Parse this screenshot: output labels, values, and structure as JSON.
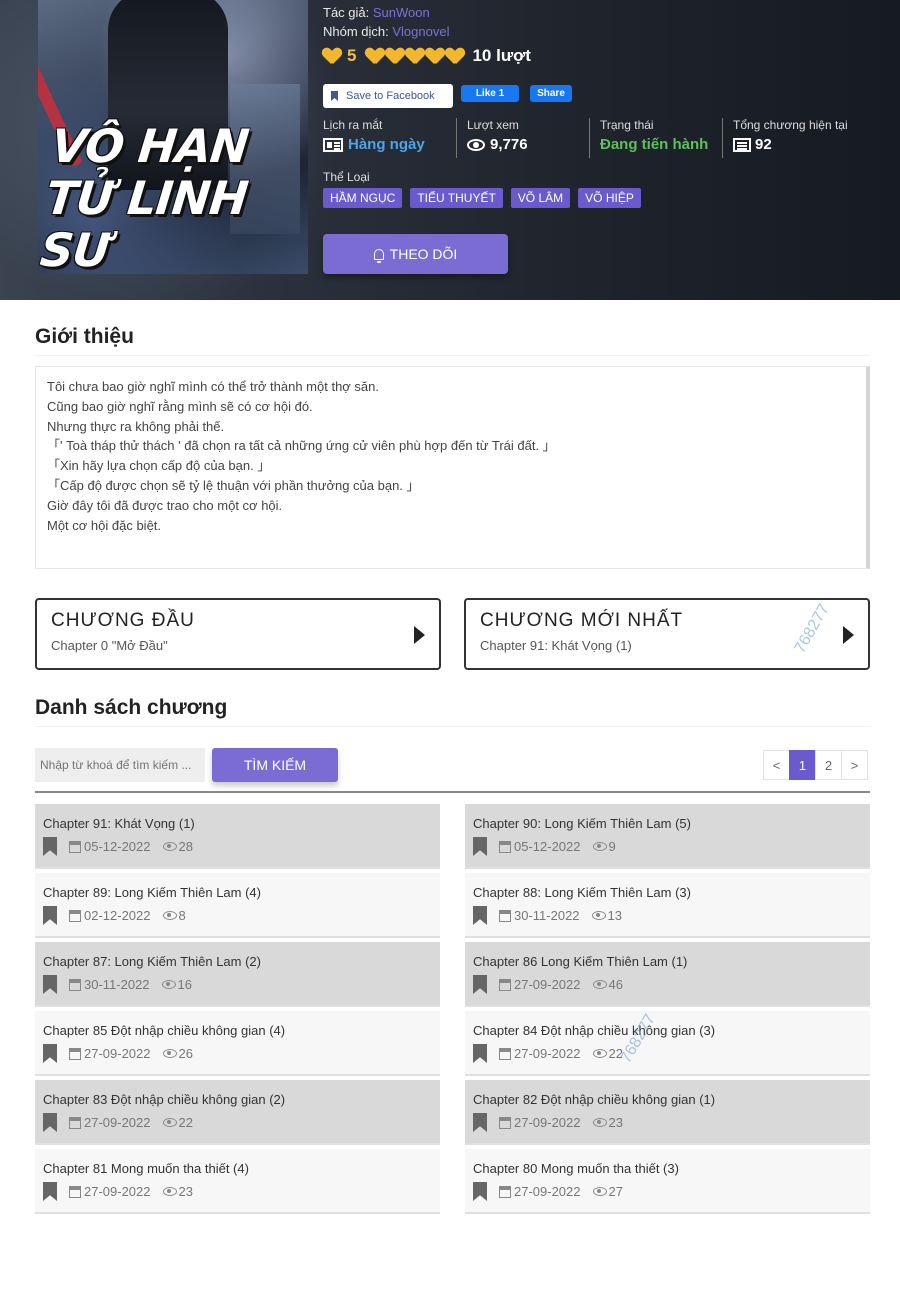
{
  "hero": {
    "cover_title_line1": "VÔ HẠN",
    "cover_title_line2": "TỬ LINH SƯ",
    "author_label": "Tác giả:",
    "author": "SunWoon",
    "group_label": "Nhóm dịch:",
    "group": "Vlognovel",
    "rating_score": "5",
    "rating_votes": "10 lượt",
    "rating_stars": 5,
    "fb_save": "Save to Facebook",
    "fb_like": "Like 1",
    "fb_share": "Share",
    "stats": {
      "release_label": "Lịch ra mắt",
      "release_value": "Hàng ngày",
      "views_label": "Lượt xem",
      "views_value": "9,776",
      "status_label": "Trạng thái",
      "status_value": "Đang tiến hành",
      "chapters_label": "Tổng chương hiện tại",
      "chapters_value": "92"
    },
    "genre_label": "Thể Loại",
    "genres": [
      "HẦM NGỤC",
      "TIỂU THUYẾT",
      "VÕ LÂM",
      "VÕ HIỆP"
    ],
    "follow_label": "THEO DÕI"
  },
  "intro": {
    "title": "Giới thiệu",
    "lines": [
      "Tôi chưa bao giờ nghĩ mình có thể trở thành một thợ săn.",
      "Cũng bao giờ nghĩ rằng mình sẽ có cơ hội đó.",
      "Nhưng thực ra không phải thế.",
      "「' Toà tháp thử thách ' đã chọn ra tất cả những ứng cử viên phù hợp đến từ Trái đất. 」",
      "「Xin hãy lựa chọn cấp độ của bạn. 」",
      "「Cấp độ được chọn sẽ tỷ lệ thuận với phần thưởng của bạn. 」",
      "Giờ đây tôi đã được trao cho một cơ hội.",
      "Một cơ hội đặc biệt."
    ]
  },
  "first_chapter": {
    "title": "CHƯƠNG ĐẦU",
    "subtitle": "Chapter 0 \"Mở Đầu\""
  },
  "latest_chapter": {
    "title": "CHƯƠNG MỚI NHẤT",
    "subtitle": "Chapter 91: Khát Vọng (1)"
  },
  "watermark": "768277",
  "chapter_list": {
    "title": "Danh sách chương",
    "search_placeholder": "Nhập từ khoá để tìm kiếm ...",
    "search_button": "TÌM KIẾM",
    "pages": [
      "<",
      "1",
      "2",
      ">"
    ],
    "active_page": "1",
    "items": [
      {
        "name": "Chapter 91: Khát Vọng (1)",
        "date": "05-12-2022",
        "views": "28"
      },
      {
        "name": "Chapter 90: Long Kiếm Thiên Lam (5)",
        "date": "05-12-2022",
        "views": "9"
      },
      {
        "name": "Chapter 89: Long Kiếm Thiên Lam (4)",
        "date": "02-12-2022",
        "views": "8"
      },
      {
        "name": "Chapter 88: Long Kiếm Thiên Lam (3)",
        "date": "30-11-2022",
        "views": "13"
      },
      {
        "name": "Chapter 87: Long Kiếm Thiên Lam (2)",
        "date": "30-11-2022",
        "views": "16"
      },
      {
        "name": "Chapter 86 Long Kiếm Thiên Lam (1)",
        "date": "27-09-2022",
        "views": "46"
      },
      {
        "name": "Chapter 85 Đột nhập chiều không gian (4)",
        "date": "27-09-2022",
        "views": "26"
      },
      {
        "name": "Chapter 84 Đột nhập chiều không gian (3)",
        "date": "27-09-2022",
        "views": "22"
      },
      {
        "name": "Chapter 83 Đột nhập chiều không gian (2)",
        "date": "27-09-2022",
        "views": "22"
      },
      {
        "name": "Chapter 82 Đột nhập chiều không gian (1)",
        "date": "27-09-2022",
        "views": "23"
      },
      {
        "name": "Chapter 81 Mong muốn tha thiết (4)",
        "date": "27-09-2022",
        "views": "23"
      },
      {
        "name": "Chapter 80 Mong muốn tha thiết (3)",
        "date": "27-09-2022",
        "views": "27"
      }
    ]
  },
  "colors": {
    "accent": "#6a5acd",
    "link": "#7d72d9",
    "star": "#f2b72d",
    "status": "#5cc15c",
    "release": "#4ba5e8"
  }
}
